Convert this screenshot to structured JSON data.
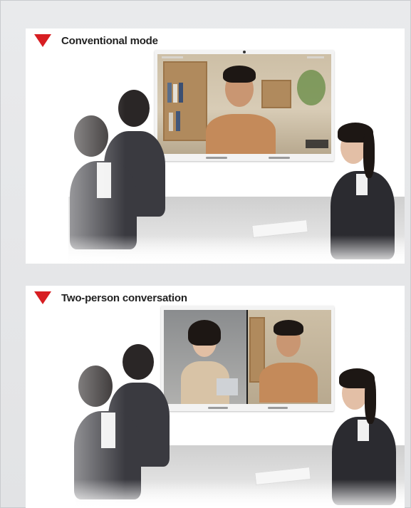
{
  "sections": [
    {
      "title": "Conventional mode"
    },
    {
      "title": "Two-person conversation"
    }
  ],
  "colors": {
    "accent_triangle": "#d71e22",
    "background": "#e6e7e9",
    "panel": "#ffffff"
  },
  "icons": [
    "triangle-down-icon"
  ]
}
